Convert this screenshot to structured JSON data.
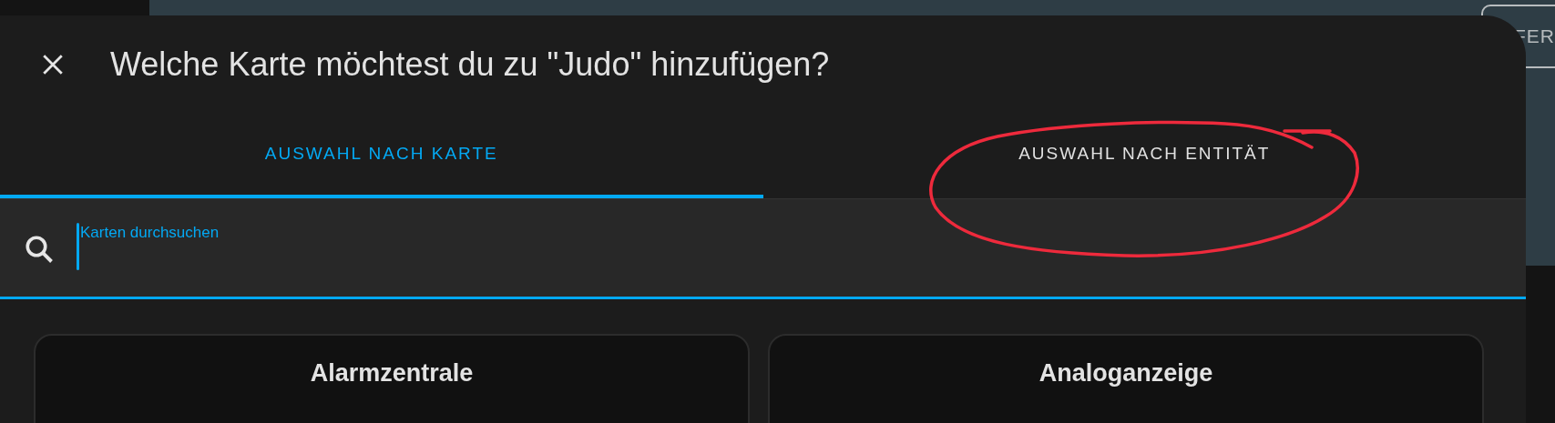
{
  "background_button": {
    "label": "FER"
  },
  "dialog": {
    "title": "Welche Karte möchtest du zu \"Judo\" hinzufügen?"
  },
  "tabs": [
    {
      "label": "AUSWAHL NACH KARTE",
      "selected": true
    },
    {
      "label": "AUSWAHL NACH ENTITÄT",
      "selected": false
    }
  ],
  "search": {
    "placeholder": "Karten durchsuchen",
    "focused": true
  },
  "cards": [
    {
      "title": "Alarmzentrale"
    },
    {
      "title": "Analoganzeige"
    }
  ],
  "annotation": {
    "kind": "ellipse",
    "color": "#ee2a3c"
  }
}
